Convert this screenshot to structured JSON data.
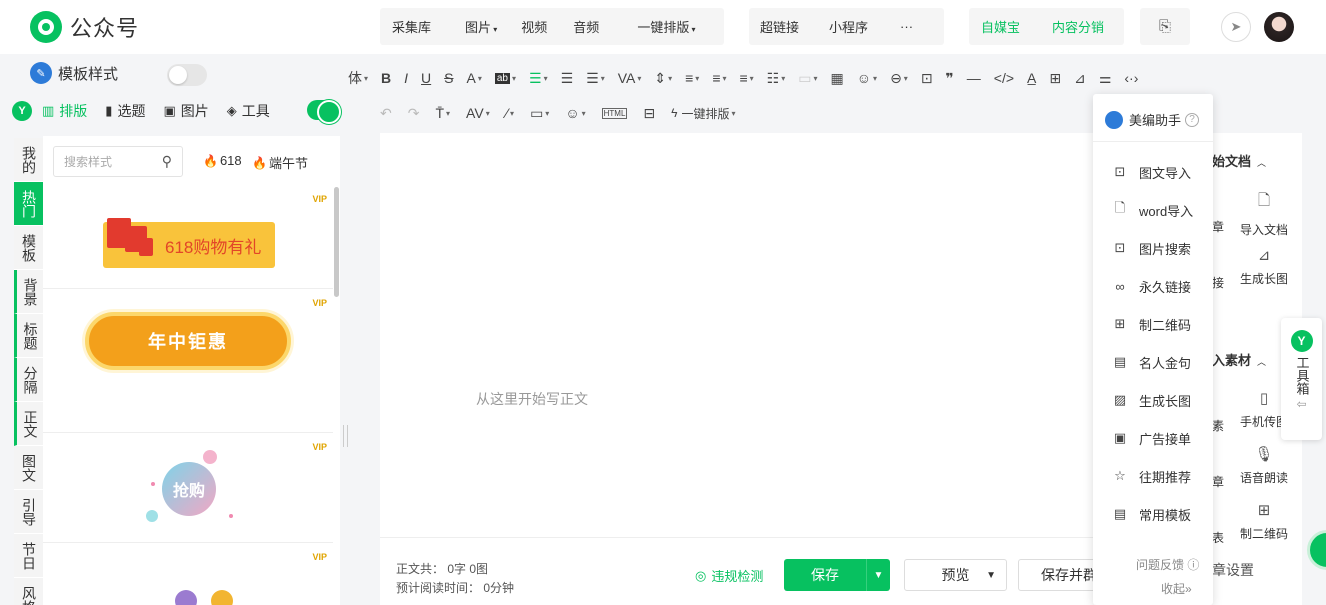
{
  "app": {
    "title": "公众号"
  },
  "top_nav": {
    "group1": [
      "采集库",
      "图片",
      "视频",
      "音频",
      "一键排版"
    ],
    "group2": [
      "超链接",
      "小程序",
      "···"
    ],
    "group3": [
      "自媒宝",
      "内容分销"
    ]
  },
  "template_style": {
    "label": "模板样式",
    "enabled": false
  },
  "left_tabs": {
    "layout": "排版",
    "topic": "选题",
    "image": "图片",
    "tools": "工具"
  },
  "categories": [
    "我的",
    "热门",
    "模板",
    "背景",
    "标题",
    "分隔",
    "正文",
    "图文",
    "引导",
    "节日",
    "风格"
  ],
  "template_panel": {
    "search_placeholder": "搜索样式",
    "hot_tags": [
      "618",
      "端午节"
    ],
    "vip_label": "VIP",
    "card1_text": "618购物有礼",
    "card2_text": "年中钜惠",
    "card3_text": "抢购"
  },
  "toolbar": {
    "font_label": "体",
    "one_click_layout": "一键排版"
  },
  "editor": {
    "placeholder": "从这里开始写正文",
    "word_count": "正文共： 0字 0图",
    "read_time": "预计阅读时间： 0分钟",
    "violation_check": "违规检测",
    "save": "保存",
    "preview": "预览",
    "save_send": "保存并群发"
  },
  "assistant": {
    "title": "美编助手",
    "items": [
      "图文导入",
      "word导入",
      "图片搜索",
      "永久链接",
      "制二维码",
      "名人金句",
      "生成长图",
      "广告接单",
      "往期推荐",
      "常用模板"
    ],
    "feedback": "问题反馈",
    "collapse": "收起»"
  },
  "right_panel": {
    "section1_title": "始文档",
    "import_doc": "导入文档",
    "long_image": "生成长图",
    "section2_title": "入素材",
    "phone_upload": "手机传图",
    "voice_read": "语音朗读",
    "qr_code": "制二维码",
    "trunc_zhang": "章",
    "trunc_jie": "接",
    "trunc_su": "素",
    "trunc_zhang2": "章",
    "trunc_biao": "表",
    "settings": "章设置"
  },
  "toolbox": {
    "label": "工具箱"
  },
  "colors": {
    "accent": "#07c160",
    "vip": "#e0a400",
    "banner": "#f3a01b"
  }
}
